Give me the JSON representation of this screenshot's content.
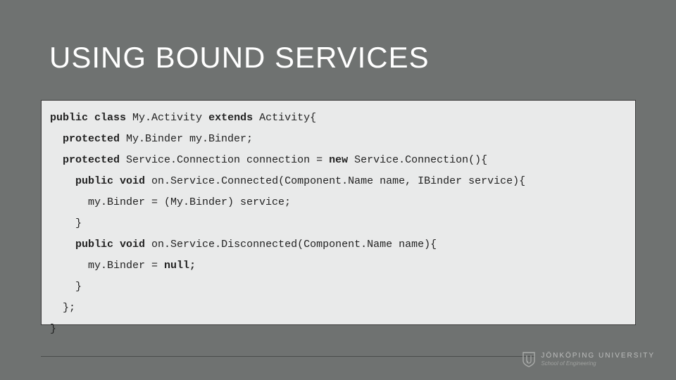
{
  "title": "USING BOUND SERVICES",
  "code": {
    "l1a": "public class",
    "l1b": " My.Activity ",
    "l1c": "extends",
    "l1d": " Activity{",
    "l2a": "  ",
    "l2b": "protected",
    "l2c": " My.Binder my.Binder;",
    "l3a": "  ",
    "l3b": "protected",
    "l3c": " Service.Connection connection = ",
    "l3d": "new",
    "l3e": " Service.Connection(){",
    "l4a": "    ",
    "l4b": "public void",
    "l4c": " on.Service.Connected(Component.Name name, IBinder service){",
    "l5": "      my.Binder = (My.Binder) service;",
    "l6": "    }",
    "l7a": "    ",
    "l7b": "public void",
    "l7c": " on.Service.Disconnected(Component.Name name){",
    "l8a": "      my.Binder = ",
    "l8b": "null;",
    "l9": "    }",
    "l10": "  };",
    "l11": "}"
  },
  "logo": {
    "name": "JÖNKÖPING UNIVERSITY",
    "sub": "School of Engineering"
  }
}
